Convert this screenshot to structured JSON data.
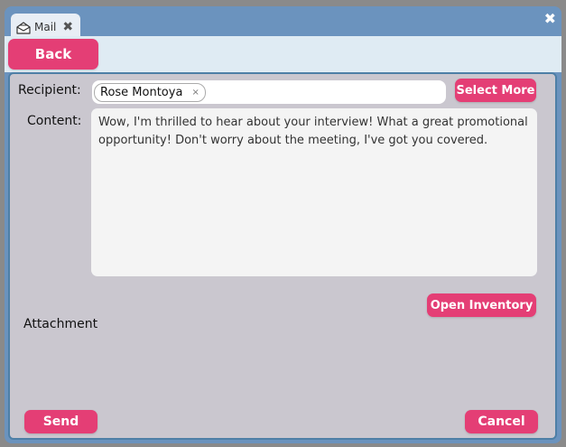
{
  "tab": {
    "label": "Mail",
    "icon": "envelope-open-icon"
  },
  "toolbar": {
    "back_label": "Back"
  },
  "form": {
    "recipient_label": "Recipient:",
    "recipient_chips": [
      {
        "name": "Rose Montoya"
      }
    ],
    "select_more_label": "Select More",
    "content_label": "Content:",
    "content_text": "Wow, I'm thrilled to hear about your interview! What a great promotional opportunity! Don't worry about the meeting, I've got you covered.",
    "open_inventory_label": "Open Inventory",
    "attachment_label": "Attachment",
    "send_label": "Send",
    "cancel_label": "Cancel"
  },
  "colors": {
    "accent": "#e43e75",
    "window_frame": "#6b93be",
    "panel_bg": "#cac7cf",
    "toolbar_bg": "#dfebf3"
  }
}
